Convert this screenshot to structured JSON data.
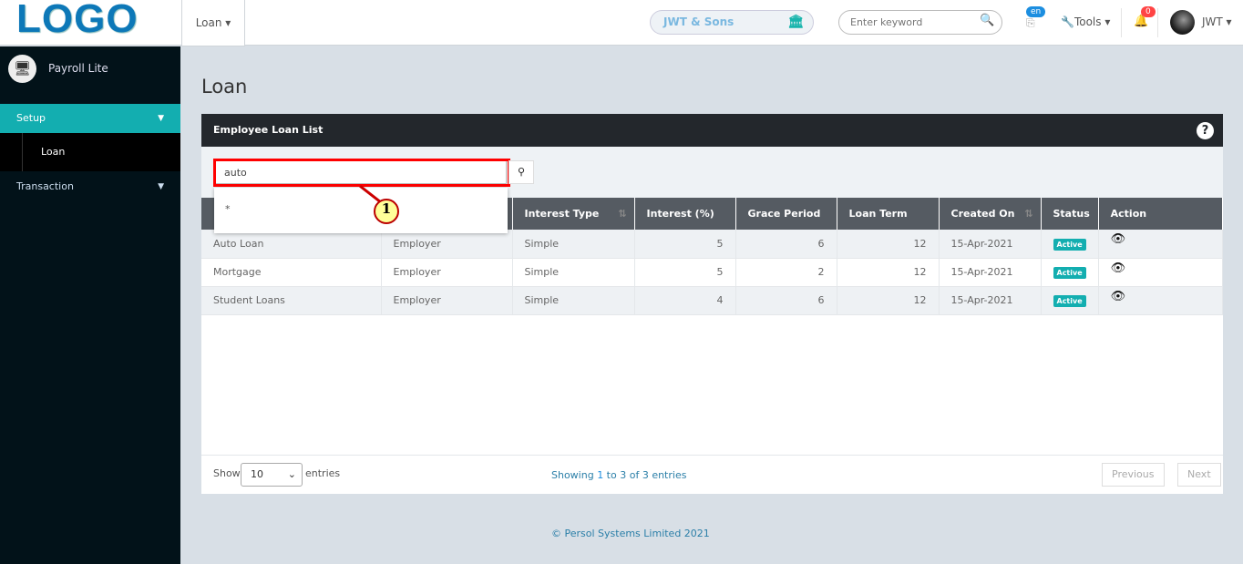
{
  "header": {
    "logo": "LOGO",
    "menu": "Loan",
    "company": "JWT & Sons",
    "search_placeholder": "Enter keyword",
    "lang": "en",
    "tools": "Tools",
    "notifications": "0",
    "user": "JWT"
  },
  "sidebar": {
    "app": "Payroll Lite",
    "items": [
      {
        "label": "Setup"
      },
      {
        "label": "Loan"
      },
      {
        "label": "Transaction"
      }
    ]
  },
  "page": {
    "title": "Loan",
    "panel_title": "Employee Loan List",
    "filter_value": "auto",
    "dropdown_item": "*",
    "callout": "1"
  },
  "table": {
    "headers": [
      "",
      "",
      "Interest Type",
      "Interest (%)",
      "Grace Period",
      "Loan Term",
      "Created On",
      "Status",
      "Action"
    ],
    "rows": [
      [
        "Auto Loan",
        "Employer",
        "Simple",
        "5",
        "6",
        "12",
        "15-Apr-2021",
        "Active"
      ],
      [
        "Mortgage",
        "Employer",
        "Simple",
        "5",
        "2",
        "12",
        "15-Apr-2021",
        "Active"
      ],
      [
        "Student Loans",
        "Employer",
        "Simple",
        "4",
        "6",
        "12",
        "15-Apr-2021",
        "Active"
      ]
    ]
  },
  "footer": {
    "show": "Show",
    "page_size": "10",
    "entries": "entries",
    "info_pre": "Showing ",
    "info_from": "1",
    "info_post": " to 3 of 3 entries",
    "previous": "Previous",
    "next": "Next",
    "copyright": "© Persol Systems Limited 2021"
  },
  "colors": {
    "accent": "#13aeb0",
    "sidebar": "#021219",
    "header_row": "#555b62",
    "highlight": "#ff0000"
  }
}
